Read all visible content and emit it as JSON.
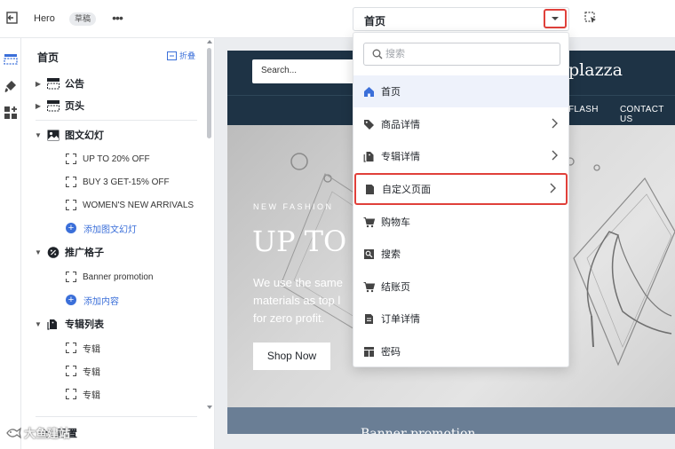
{
  "topbar": {
    "theme_name": "Hero",
    "status_badge": "草稿",
    "more_label": "•••",
    "page_selector_label": "首页"
  },
  "panel": {
    "title": "首页",
    "collapse_label": "折叠",
    "sections": {
      "announcement": "公告",
      "header": "页头",
      "slideshow": "图文幻灯",
      "promo_grid": "推广格子",
      "collection_list": "专辑列表"
    },
    "slideshow_blocks": [
      "UP TO 20% OFF",
      "BUY 3 GET-15% OFF",
      "WOMEN'S NEW ARRIVALS"
    ],
    "add_slide": "添加图文幻灯",
    "promo_blocks": [
      "Banner promotion"
    ],
    "add_content": "添加内容",
    "collection_blocks": [
      "专辑",
      "专辑",
      "专辑"
    ],
    "global_settings": "全局配置"
  },
  "preview": {
    "search_placeholder": "Search...",
    "logo_fragment": "plazza",
    "nav_items": [
      "FLASH",
      "CONTACT US"
    ],
    "hero_eyebrow": "NEW FASHION",
    "hero_title": "UP TO",
    "hero_body_lines": [
      "We use the same",
      "materials as top l",
      "for zero profit."
    ],
    "shop_button": "Shop Now",
    "banner_title": "Banner promotion"
  },
  "dropdown": {
    "search_placeholder": "搜索",
    "items": [
      {
        "label": "首页",
        "icon": "home-icon",
        "active": true,
        "has_children": false
      },
      {
        "label": "商品详情",
        "icon": "tag-icon",
        "active": false,
        "has_children": true
      },
      {
        "label": "专辑详情",
        "icon": "collection-icon",
        "active": false,
        "has_children": true
      },
      {
        "label": "自定义页面",
        "icon": "page-icon",
        "active": false,
        "has_children": true,
        "highlighted": true
      },
      {
        "label": "购物车",
        "icon": "cart-icon",
        "active": false,
        "has_children": false
      },
      {
        "label": "搜索",
        "icon": "image-search-icon",
        "active": false,
        "has_children": false
      },
      {
        "label": "结账页",
        "icon": "checkout-cart-icon",
        "active": false,
        "has_children": false
      },
      {
        "label": "订单详情",
        "icon": "order-icon",
        "active": false,
        "has_children": false
      },
      {
        "label": "密码",
        "icon": "password-icon",
        "active": false,
        "has_children": false
      }
    ]
  },
  "watermark": "大鱼建站",
  "colors": {
    "accent": "#3b6fd9",
    "highlight_border": "#e0403a",
    "store_navy": "#1e3345",
    "banner_blue": "#6a7e95"
  }
}
